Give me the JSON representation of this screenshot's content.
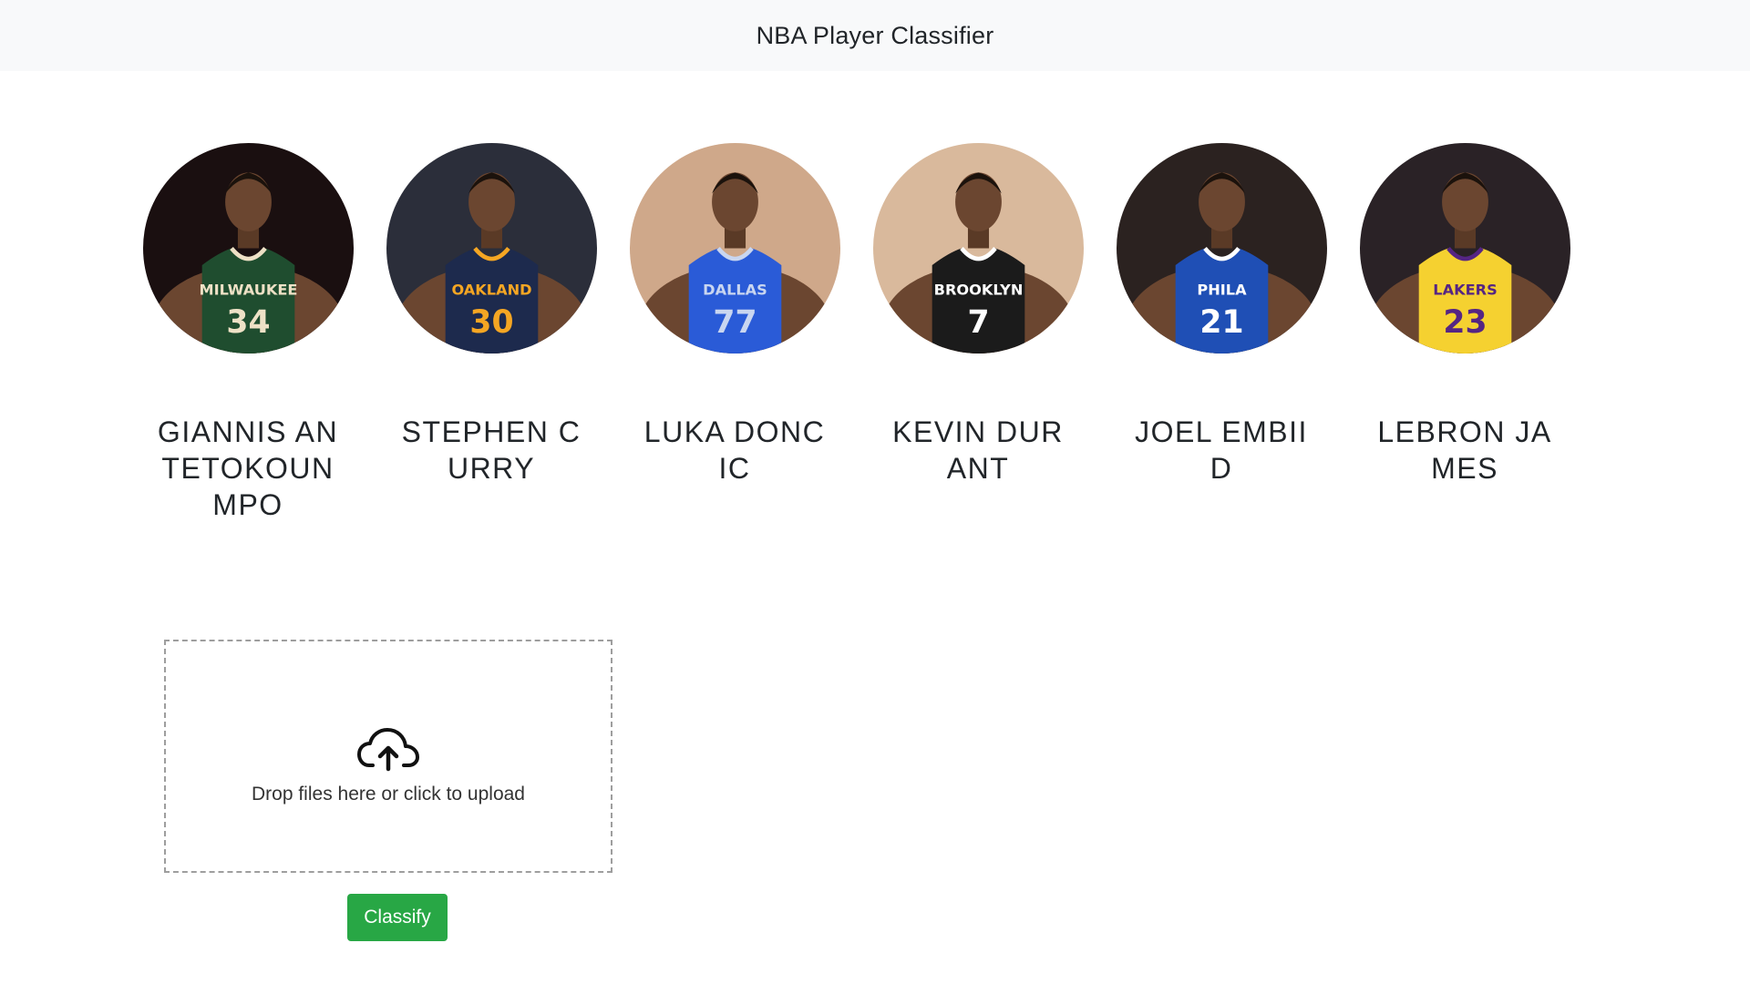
{
  "navbar": {
    "title": "NBA Player Classifier"
  },
  "players": [
    {
      "name": "GIANNIS ANTETOKOUNMPO",
      "jersey_number": "34",
      "jersey_text": "MILWAUKEE",
      "jersey_color": "#1f4d2f",
      "accent": "#eee1c6",
      "bg": "#1a0f10"
    },
    {
      "name": "STEPHEN CURRY",
      "jersey_number": "30",
      "jersey_text": "OAKLAND",
      "jersey_color": "#1d2a4d",
      "accent": "#f5a623",
      "bg": "#2b2e3a"
    },
    {
      "name": "LUKA DONCIC",
      "jersey_number": "77",
      "jersey_text": "DALLAS",
      "jersey_color": "#2a5bd7",
      "accent": "#c9d6f0",
      "bg": "#cfa88a"
    },
    {
      "name": "KEVIN DURANT",
      "jersey_number": "7",
      "jersey_text": "BROOKLYN",
      "jersey_color": "#1b1b1b",
      "accent": "#ffffff",
      "bg": "#d9b99c"
    },
    {
      "name": "JOEL EMBIID",
      "jersey_number": "21",
      "jersey_text": "PHILA",
      "jersey_color": "#1f4fb5",
      "accent": "#ffffff",
      "bg": "#2b2220"
    },
    {
      "name": "LEBRON JAMES",
      "jersey_number": "23",
      "jersey_text": "LAKERS",
      "jersey_color": "#f5d130",
      "accent": "#552583",
      "bg": "#2a2226"
    }
  ],
  "upload": {
    "icon": "cloud-upload-icon",
    "text": "Drop files here or click to upload"
  },
  "classify_button": {
    "label": "Classify",
    "color": "#28a745"
  }
}
